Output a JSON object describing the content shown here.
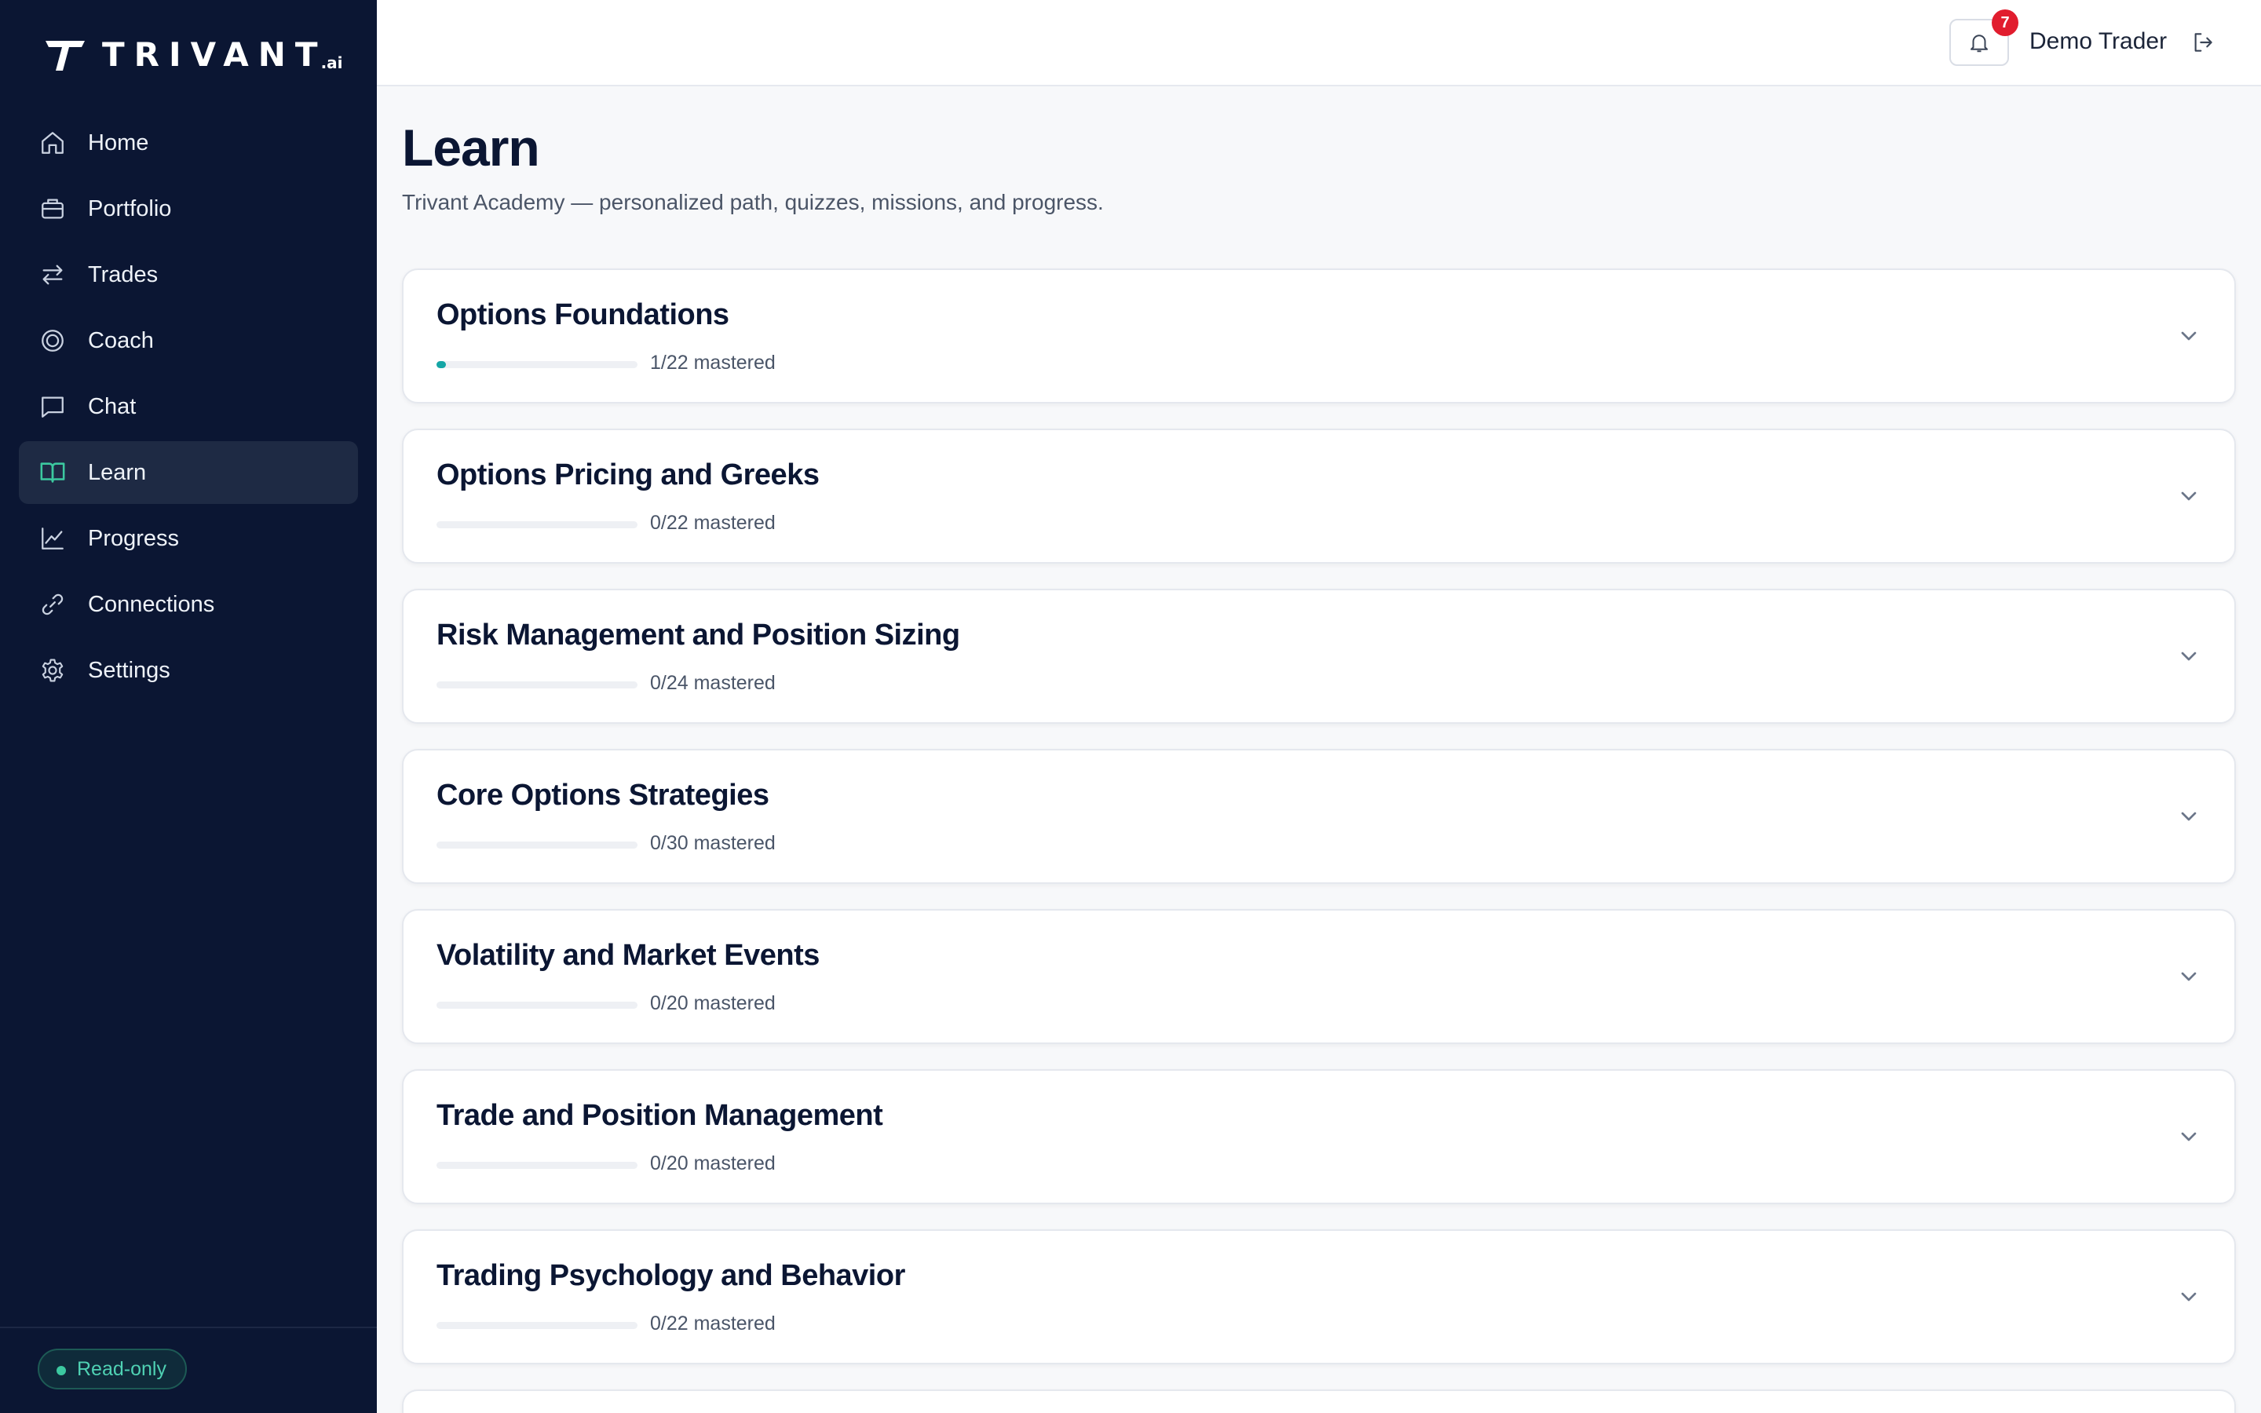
{
  "brand": {
    "name": "TRIVANT",
    "suffix": ".ai"
  },
  "sidebar": {
    "items": [
      {
        "label": "Home",
        "icon": "home-icon",
        "active": false
      },
      {
        "label": "Portfolio",
        "icon": "briefcase-icon",
        "active": false
      },
      {
        "label": "Trades",
        "icon": "arrows-swap-icon",
        "active": false
      },
      {
        "label": "Coach",
        "icon": "target-icon",
        "active": false
      },
      {
        "label": "Chat",
        "icon": "chat-bubble-icon",
        "active": false
      },
      {
        "label": "Learn",
        "icon": "book-open-icon",
        "active": true
      },
      {
        "label": "Progress",
        "icon": "line-chart-icon",
        "active": false
      },
      {
        "label": "Connections",
        "icon": "link-icon",
        "active": false
      },
      {
        "label": "Settings",
        "icon": "gear-icon",
        "active": false
      }
    ],
    "footer_badge": "Read-only"
  },
  "header": {
    "notification_count": "7",
    "user_name": "Demo Trader"
  },
  "page": {
    "title": "Learn",
    "subtitle": "Trivant Academy — personalized path, quizzes, missions, and progress."
  },
  "courses": [
    {
      "title": "Options Foundations",
      "progress_text": "1/22 mastered",
      "progress": 0.045
    },
    {
      "title": "Options Pricing and Greeks",
      "progress_text": "0/22 mastered",
      "progress": 0
    },
    {
      "title": "Risk Management and Position Sizing",
      "progress_text": "0/24 mastered",
      "progress": 0
    },
    {
      "title": "Core Options Strategies",
      "progress_text": "0/30 mastered",
      "progress": 0
    },
    {
      "title": "Volatility and Market Events",
      "progress_text": "0/20 mastered",
      "progress": 0
    },
    {
      "title": "Trade and Position Management",
      "progress_text": "0/20 mastered",
      "progress": 0
    },
    {
      "title": "Trading Psychology and Behavior",
      "progress_text": "0/22 mastered",
      "progress": 0
    }
  ],
  "colors": {
    "sidebar_bg": "#0b1633",
    "accent": "#15a6a6",
    "active_icon": "#3cc9a0",
    "badge_red": "#e11d2e"
  }
}
